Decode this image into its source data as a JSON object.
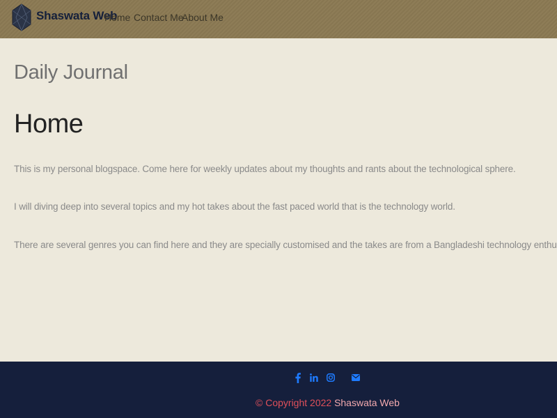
{
  "nav": {
    "brand": "Shaswata Web",
    "links": [
      "Home",
      "Contact Me",
      "About Me"
    ]
  },
  "main": {
    "site_title": "Daily Journal",
    "heading": "Home",
    "paragraphs": [
      "This is my personal blogspace. Come here for weekly updates about my thoughts and rants about the technological sphere.",
      "I will diving deep into several topics and my hot takes about the fast paced world that is the technology world.",
      "There are several genres you can find here and they are specially customised and the takes are from a Bangladeshi technology enthusiast."
    ]
  },
  "footer": {
    "social_icons": [
      "facebook-icon",
      "linkedin-icon",
      "instagram-icon",
      "envelope-icon"
    ],
    "copyright_prefix": "© Copyright 2022 ",
    "copyright_name": "Shaswata Web"
  },
  "colors": {
    "navbar_bg": "#8C7A54",
    "page_bg": "#EDE9DC",
    "footer_bg": "#151F3C",
    "social_icon": "#1E7BFF",
    "copyright_text": "#E0505A"
  }
}
